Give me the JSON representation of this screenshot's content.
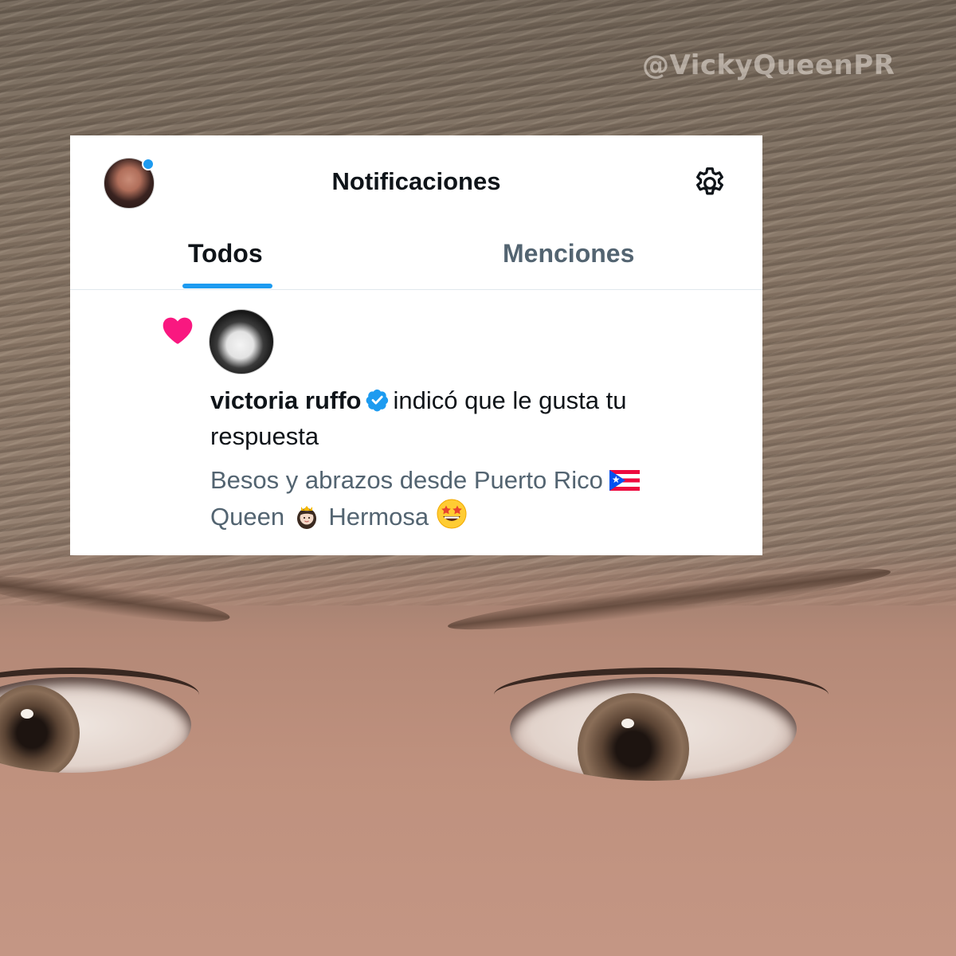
{
  "watermark": "@VickyQueenPR",
  "header": {
    "title": "Notificaciones"
  },
  "tabs": [
    {
      "label": "Todos",
      "active": true
    },
    {
      "label": "Menciones",
      "active": false
    }
  ],
  "notification": {
    "type_icon": "heart-icon",
    "user_name": "victoria ruffo",
    "verified": true,
    "action_text": "indicó que le gusta tu respuesta",
    "reply": {
      "part1": "Besos y abrazos desde Puerto Rico",
      "flag": "Puerto Rico flag",
      "part2": "Queen",
      "emoji1": "princess",
      "part3": "Hermosa",
      "emoji2": "star-struck"
    }
  },
  "colors": {
    "accent": "#1d9bf0",
    "heart": "#f91880",
    "text_primary": "#0f1419",
    "text_secondary": "#536471"
  }
}
